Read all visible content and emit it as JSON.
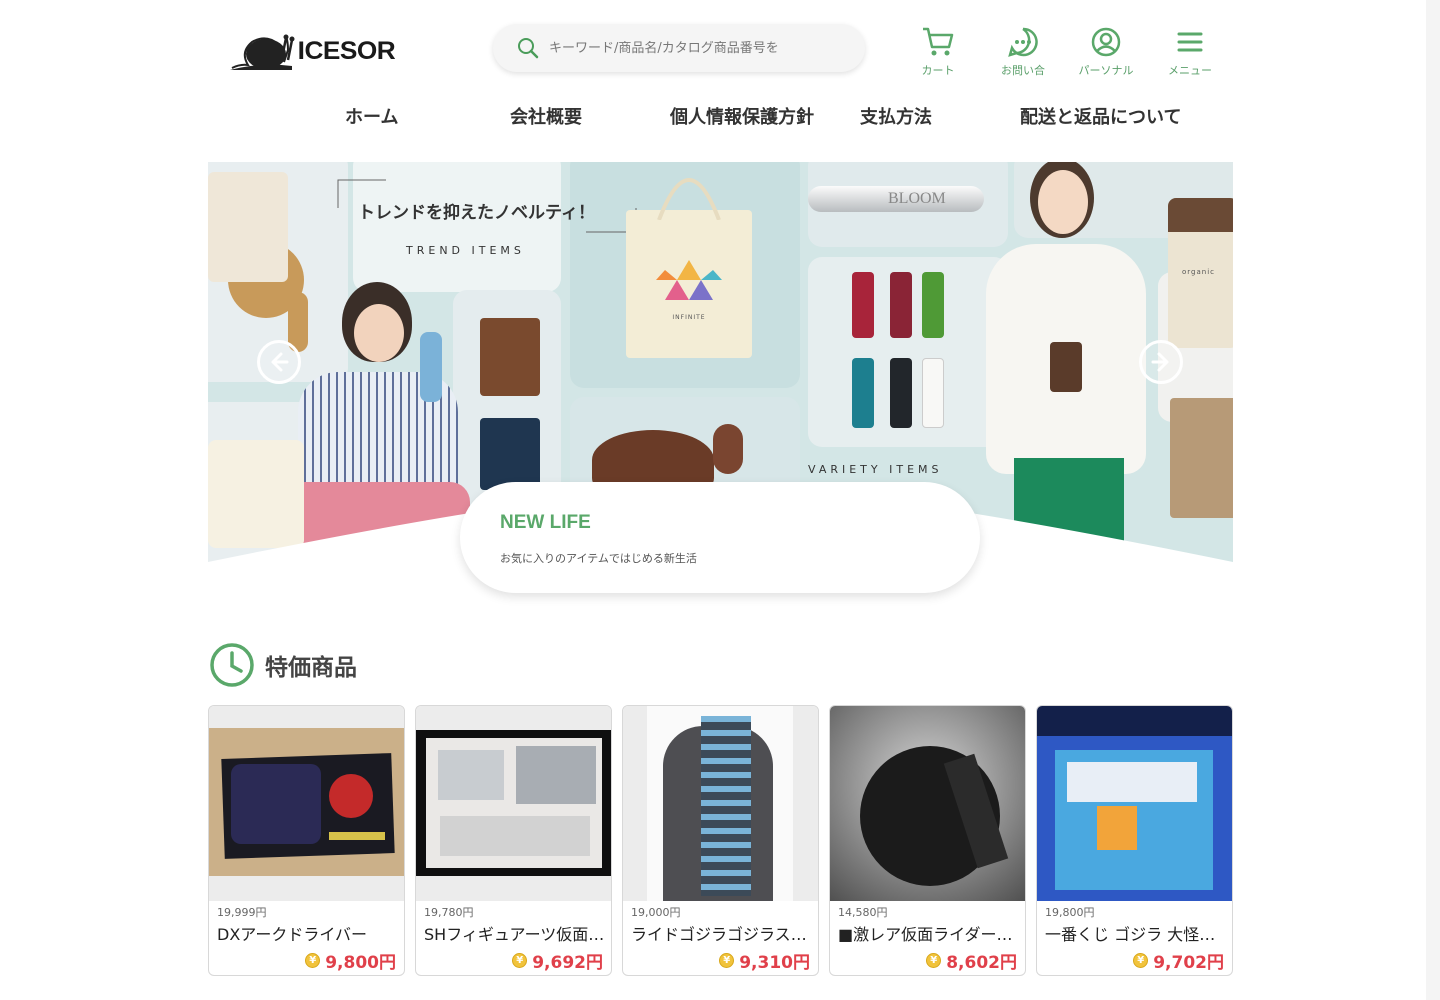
{
  "header": {
    "logo_text": "ICESOR",
    "search": {
      "placeholder": "キーワード/商品名/カタログ商品番号を",
      "value": ""
    },
    "icons": [
      {
        "name": "cart-icon",
        "label": "カート"
      },
      {
        "name": "chat-icon",
        "label": "お問い合"
      },
      {
        "name": "user-icon",
        "label": "パーソナル"
      },
      {
        "name": "menu-icon",
        "label": "メニュー"
      }
    ]
  },
  "nav": [
    "ホーム",
    "会社概要",
    "個人情報保護方針",
    "支払方法",
    "配送と返品について"
  ],
  "hero": {
    "headline": "トレンドを抑えたノベルティ！",
    "sub1": "TREND ITEMS",
    "sub2": "VARIETY ITEMS",
    "brand_bloom": "BLOOM",
    "brand_infinite": "INFINITE",
    "brand_organic": "organic",
    "card_title": "NEW LIFE",
    "card_sub": "お気に入りのアイテムではじめる新生活"
  },
  "section": {
    "title": "特価商品"
  },
  "products": [
    {
      "old_price": "19,999円",
      "name": "DXアークドライバー",
      "price": "9,800円"
    },
    {
      "old_price": "19,780円",
      "name": "SHフィギュアーツ仮面ライダー",
      "price": "9,692円"
    },
    {
      "old_price": "19,000円",
      "name": "ライドゴジラゴジラスーツ",
      "price": "9,310円"
    },
    {
      "old_price": "14,580円",
      "name": "■激レア仮面ライダーグッズ",
      "price": "8,602円"
    },
    {
      "old_price": "19,800円",
      "name": "一番くじ ゴジラ 大怪獣列伝",
      "price": "9,702円"
    }
  ],
  "colors": {
    "accent": "#5aa86a",
    "price": "#e0404a",
    "hero_bg": "#d3e6e6"
  }
}
